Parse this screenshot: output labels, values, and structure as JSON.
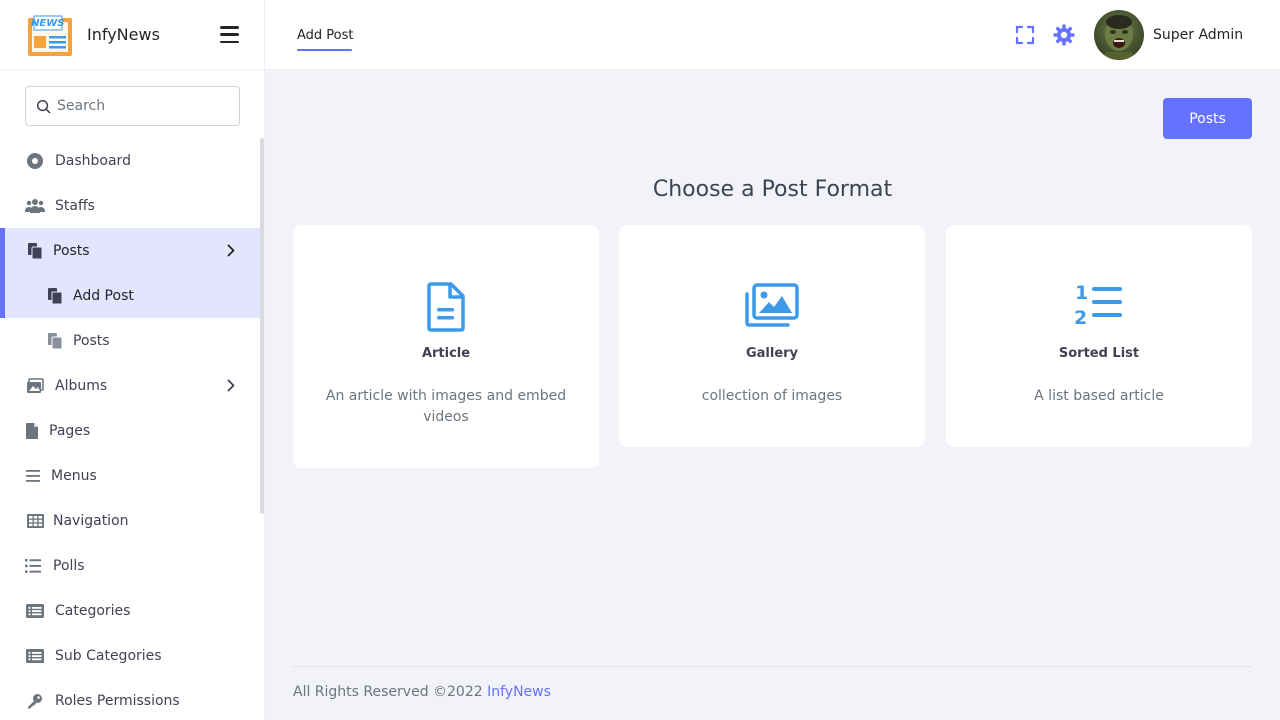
{
  "brand": {
    "name": "InfyNews",
    "logo_text": "NEWS"
  },
  "search": {
    "placeholder": "Search"
  },
  "sidebar": {
    "items": [
      {
        "label": "Dashboard"
      },
      {
        "label": "Staffs"
      },
      {
        "label": "Posts"
      },
      {
        "label": "Add Post"
      },
      {
        "label": "Posts"
      },
      {
        "label": "Albums"
      },
      {
        "label": "Pages"
      },
      {
        "label": "Menus"
      },
      {
        "label": "Navigation"
      },
      {
        "label": "Polls"
      },
      {
        "label": "Categories"
      },
      {
        "label": "Sub Categories"
      },
      {
        "label": "Roles Permissions"
      }
    ]
  },
  "header": {
    "tab_label": "Add Post",
    "user_name": "Super Admin"
  },
  "main": {
    "posts_button": "Posts",
    "title": "Choose a Post Format",
    "cards": [
      {
        "title": "Article",
        "description": "An article with images and embed videos"
      },
      {
        "title": "Gallery",
        "description": "collection of images"
      },
      {
        "title": "Sorted List",
        "description": "A list based article"
      }
    ]
  },
  "footer": {
    "text": "All Rights Reserved ©2022",
    "link": "InfyNews"
  },
  "colors": {
    "accent": "#6571ff",
    "icon_blue": "#3d9ae8",
    "active_bg": "#e3e4fd"
  }
}
